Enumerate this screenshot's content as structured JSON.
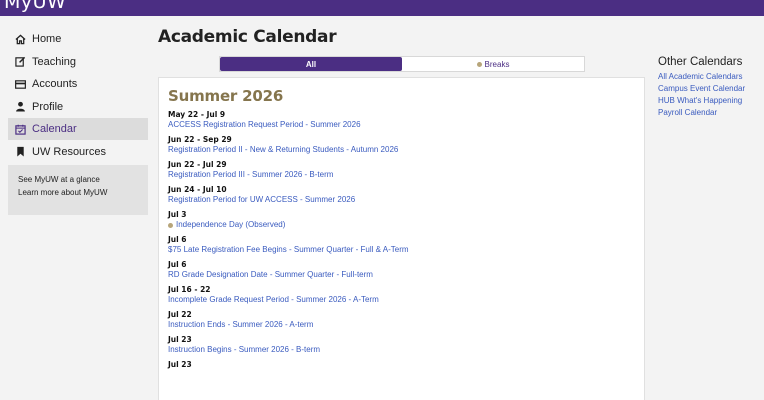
{
  "app": {
    "brand": "MyUW"
  },
  "sidebar": {
    "items": [
      {
        "label": "Home",
        "icon": "home-icon"
      },
      {
        "label": "Teaching",
        "icon": "edit-icon"
      },
      {
        "label": "Accounts",
        "icon": "credit-card-icon"
      },
      {
        "label": "Profile",
        "icon": "user-icon"
      },
      {
        "label": "Calendar",
        "icon": "calendar-check-icon",
        "active": true
      },
      {
        "label": "UW Resources",
        "icon": "bookmark-icon"
      }
    ],
    "links": [
      "See MyUW at a glance",
      "Learn more about MyUW"
    ]
  },
  "main": {
    "title": "Academic Calendar",
    "tabs": [
      {
        "label": "All",
        "active": true
      },
      {
        "label": "Breaks",
        "active": false
      }
    ],
    "season": "Summer 2026",
    "events": [
      {
        "date": "May 22 - Jul 9",
        "name": "ACCESS Registration Request Period - Summer 2026"
      },
      {
        "date": "Jun 22 - Sep 29",
        "name": "Registration Period II - New & Returning Students - Autumn 2026"
      },
      {
        "date": "Jun 22 - Jul 29",
        "name": "Registration Period III - Summer 2026 - B-term"
      },
      {
        "date": "Jun 24 - Jul 10",
        "name": "Registration Period for UW ACCESS - Summer 2026"
      },
      {
        "date": "Jul 3",
        "name": "Independence Day (Observed)",
        "break": true
      },
      {
        "date": "Jul 6",
        "name": "$75 Late Registration Fee Begins - Summer Quarter - Full & A-Term"
      },
      {
        "date": "Jul 6",
        "name": "RD Grade Designation Date - Summer Quarter - Full-term"
      },
      {
        "date": "Jul 16 - 22",
        "name": "Incomplete Grade Request Period - Summer 2026 - A-Term"
      },
      {
        "date": "Jul 22",
        "name": "Instruction Ends - Summer 2026 - A-term"
      },
      {
        "date": "Jul 23",
        "name": "Instruction Begins - Summer 2026 - B-term"
      },
      {
        "date": "Jul 23",
        "name": ""
      }
    ]
  },
  "other_calendars": {
    "title": "Other Calendars",
    "links": [
      "All Academic Calendars",
      "Campus Event Calendar",
      "HUB What's Happening",
      "Payroll Calendar"
    ]
  },
  "colors": {
    "brand": "#4b2e83",
    "gold": "#85754d",
    "link": "#3a5bbf",
    "break_dot": "#b7a57a"
  }
}
